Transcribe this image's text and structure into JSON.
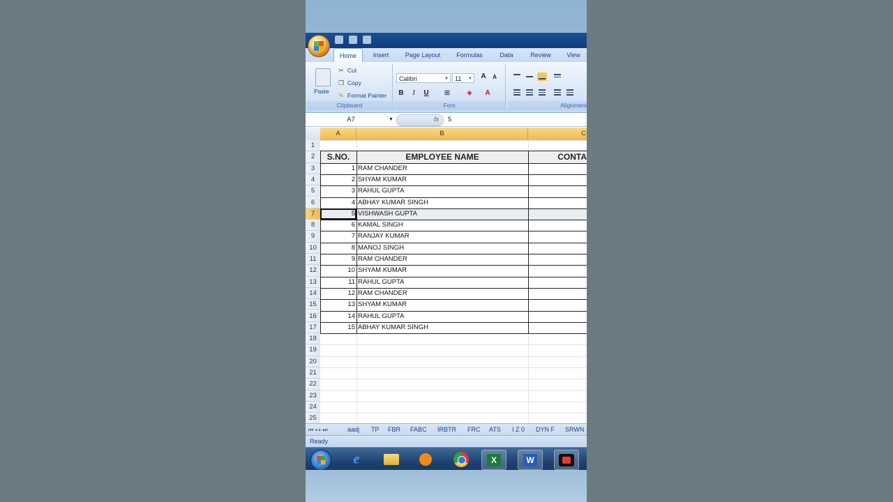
{
  "ribbon": {
    "tabs": [
      "Home",
      "Insert",
      "Page Layout",
      "Formulas",
      "Data",
      "Review",
      "View"
    ],
    "active_tab": "Home",
    "clipboard": {
      "paste": "Paste",
      "cut": "Cut",
      "copy": "Copy",
      "format_painter": "Format Painter",
      "group": "Clipboard"
    },
    "font": {
      "name": "Calibri",
      "size": "11",
      "group": "Font",
      "grow": "A",
      "shrink": "A",
      "bold": "B",
      "italic": "I",
      "underline": "U",
      "font_color": "A"
    },
    "alignment": {
      "group": "Alignment"
    }
  },
  "formula_bar": {
    "name_box": "A7",
    "fx": "fx",
    "value": "5"
  },
  "columns": {
    "a": "A",
    "b": "B",
    "c": "C"
  },
  "row_numbers": [
    "1",
    "2",
    "3",
    "4",
    "5",
    "6",
    "7",
    "8",
    "9",
    "10",
    "11",
    "12",
    "13",
    "14",
    "15",
    "16",
    "17",
    "18",
    "19",
    "20",
    "21",
    "22",
    "23",
    "24",
    "25"
  ],
  "table": {
    "headers": {
      "sno": "S.NO.",
      "name": "EMPLOYEE NAME",
      "contact": "CONTA"
    },
    "rows": [
      {
        "sno": "1",
        "name": "RAM CHANDER"
      },
      {
        "sno": "2",
        "name": "SHYAM KUMAR"
      },
      {
        "sno": "3",
        "name": "RAHUL GUPTA"
      },
      {
        "sno": "4",
        "name": "ABHAY KUMAR SINGH"
      },
      {
        "sno": "5",
        "name": "VISHWASH GUPTA"
      },
      {
        "sno": "6",
        "name": "KAMAL SINGH"
      },
      {
        "sno": "7",
        "name": "RANJAY KUMAR"
      },
      {
        "sno": "8",
        "name": "MANOJ SINGH"
      },
      {
        "sno": "9",
        "name": "RAM CHANDER"
      },
      {
        "sno": "10",
        "name": "SHYAM KUMAR"
      },
      {
        "sno": "11",
        "name": "RAHUL GUPTA"
      },
      {
        "sno": "12",
        "name": "RAM CHANDER"
      },
      {
        "sno": "13",
        "name": "SHYAM KUMAR"
      },
      {
        "sno": "14",
        "name": "RAHUL GUPTA"
      },
      {
        "sno": "15",
        "name": "ABHAY KUMAR SINGH"
      }
    ]
  },
  "sheet_tabs": [
    "aadj",
    "TP",
    "FBR",
    "FABC",
    "IRBTR",
    "FRC",
    "ATS",
    "I Z 0",
    "DYN F",
    "SRWN"
  ],
  "status": {
    "text": "Ready"
  },
  "taskbar": {
    "items": [
      "start-orb-icon",
      "internet-explorer-icon",
      "file-explorer-icon",
      "media-player-icon",
      "chrome-icon",
      "excel-icon",
      "word-icon",
      "screen-recorder-icon"
    ]
  },
  "colors": {
    "selected_header": "#f0b94a",
    "ribbon": "#c6d9f1",
    "title": "#0f3c7d"
  }
}
